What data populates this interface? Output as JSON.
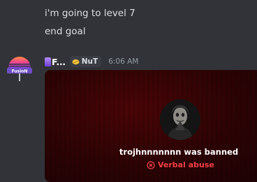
{
  "messages": {
    "line1": "i'm going to level 7",
    "line2": "end goal"
  },
  "author": {
    "avatar_text": "FusioN",
    "name": "F...",
    "tag": "NuT",
    "tag_icon": "leaf-icon",
    "timestamp": "6:06 AM"
  },
  "embed": {
    "ban_text": "trojhnnnnnnn was banned",
    "reason": "Verbal abuse",
    "reason_icon": "x-circle-icon",
    "reason_color": "#f23f43",
    "background_color": "#2c0304"
  }
}
